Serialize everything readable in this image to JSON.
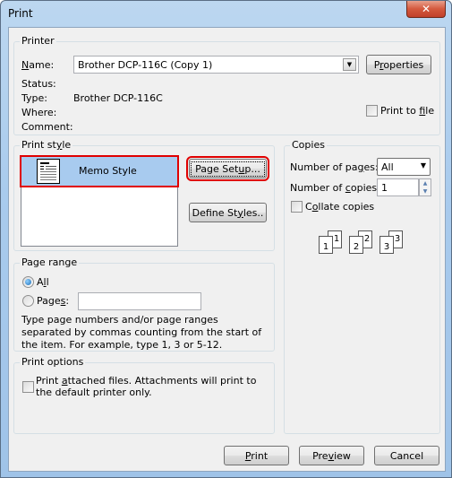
{
  "window": {
    "title": "Print",
    "close_icon": "close-icon"
  },
  "printer": {
    "group_label": "Printer",
    "name_label": "Name:",
    "name_value": "Brother DCP-116C (Copy 1)",
    "properties_button": "Properties",
    "status_label": "Status:",
    "status_value": "",
    "type_label": "Type:",
    "type_value": "Brother DCP-116C",
    "where_label": "Where:",
    "where_value": "",
    "comment_label": "Comment:",
    "comment_value": "",
    "print_to_file_label": "Print to file",
    "print_to_file_checked": false
  },
  "print_style": {
    "group_label": "Print style",
    "styles": [
      {
        "label": "Memo Style",
        "icon": "memo-style-icon",
        "selected": true
      }
    ],
    "page_setup_button": "Page Setup...",
    "define_styles_button": "Define Styles.."
  },
  "copies": {
    "group_label": "Copies",
    "pages_label": "Number of pages:",
    "pages_value": "All",
    "copies_label": "Number of copies:",
    "copies_value": "1",
    "collate_label": "Collate copies",
    "collate_checked": false,
    "collate_pages": [
      "1",
      "1",
      "2",
      "2",
      "3",
      "3"
    ]
  },
  "page_range": {
    "group_label": "Page range",
    "all_label": "All",
    "all_selected": true,
    "pages_label": "Pages:",
    "pages_value": "",
    "help_text": "Type page numbers and/or page ranges separated by commas counting from the start of the item.  For example, type 1, 3 or 5-12."
  },
  "print_options": {
    "group_label": "Print options",
    "attached_label": "Print attached files.  Attachments will print to the default printer only.",
    "attached_checked": false
  },
  "footer": {
    "print_button": "Print",
    "preview_button": "Preview",
    "cancel_button": "Cancel"
  }
}
